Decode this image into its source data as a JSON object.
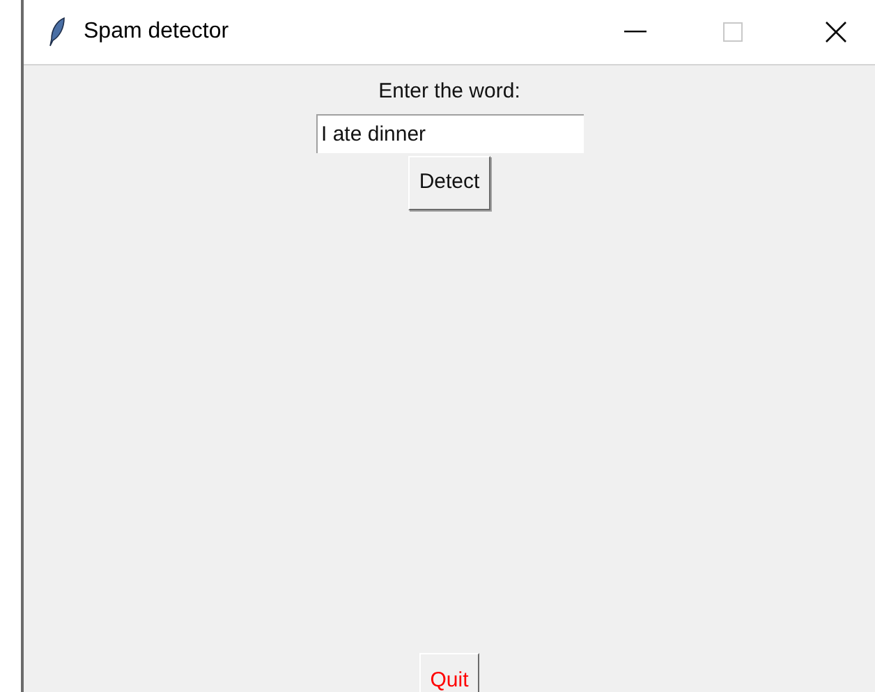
{
  "window": {
    "title": "Spam detector"
  },
  "form": {
    "label": "Enter the word:",
    "field": {
      "value": "I ate dinner"
    },
    "detect_button": "Detect"
  },
  "quit_button": "Quit"
}
